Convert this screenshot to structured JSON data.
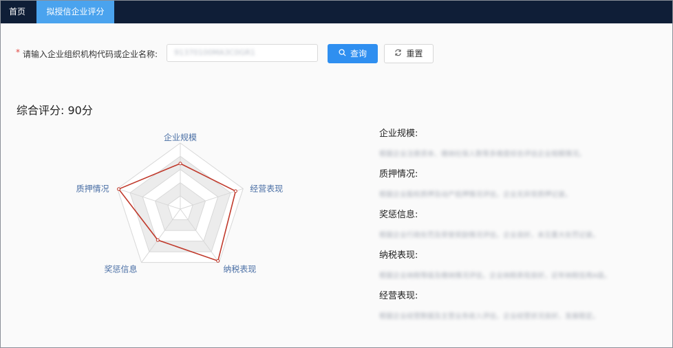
{
  "nav": {
    "home": "首页",
    "active_tab": "拟授信企业评分"
  },
  "search": {
    "required_mark": "*",
    "label": "请输入企业组织机构代码或企业名称:",
    "value": "91370100MA3C0GR1",
    "query_label": "查询",
    "reset_label": "重置"
  },
  "score": {
    "label": "综合评分:",
    "value": "90分"
  },
  "radar": {
    "indicators": [
      "企业规模",
      "经营表现",
      "纳税表现",
      "奖惩信息",
      "质押情况"
    ],
    "values": [
      0.69,
      0.88,
      0.97,
      0.58,
      0.98
    ],
    "max": 1,
    "line_color": "#c0392b",
    "label_color": "#4a6fa5",
    "band_color": "#ececec"
  },
  "descriptions": [
    {
      "title": "企业规模:",
      "text": "根据企业注册资本、缴纳社保人数等多维度综合评估企业规模情况。"
    },
    {
      "title": "质押情况:",
      "text": "根据企业股权质押及动产抵押情况评估，企业无异常质押记录。"
    },
    {
      "title": "奖惩信息:",
      "text": "根据企业行政处罚及荣誉奖励情况评估，企业良好，未见重大处罚记录。"
    },
    {
      "title": "纳税表现:",
      "text": "根据企业纳税等级及缴纳情况评估，企业纳税表现良好，近年纳税信用A级。"
    },
    {
      "title": "经营表现:",
      "text": "根据企业经营数据及主营业务收入评估，企业经营状况良好，发展稳定。"
    }
  ]
}
